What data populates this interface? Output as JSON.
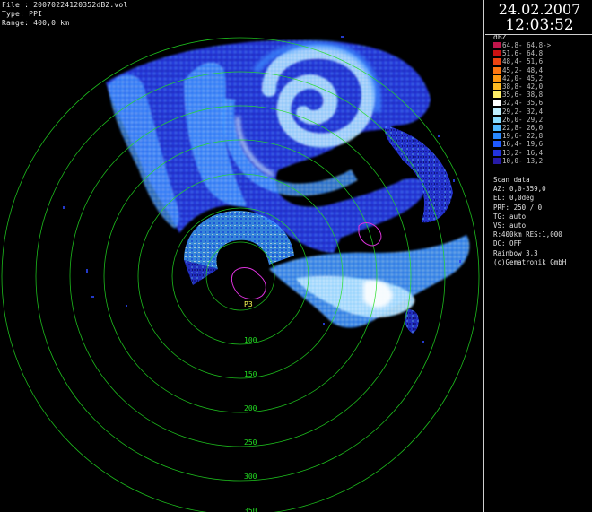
{
  "header": {
    "file": "File : 20070224120352dBZ.vol",
    "type": "Type: PPI",
    "range": "Range: 400,0 km"
  },
  "clock": {
    "date": "24.02.2007",
    "time": "12:03:52"
  },
  "legend": {
    "unit": "dBZ",
    "items": [
      {
        "label": "64,8- 64,8->",
        "color": "#c0154a"
      },
      {
        "label": "51,6- 64,8",
        "color": "#cc1111"
      },
      {
        "label": "48,4- 51,6",
        "color": "#ee4411"
      },
      {
        "label": "45,2- 48,4",
        "color": "#ff7711"
      },
      {
        "label": "42,0- 45,2",
        "color": "#ff9911"
      },
      {
        "label": "38,8- 42,0",
        "color": "#ffbb22"
      },
      {
        "label": "35,6- 38,8",
        "color": "#ffee66"
      },
      {
        "label": "32,4- 35,6",
        "color": "#ffffff"
      },
      {
        "label": "29,2- 32,4",
        "color": "#bfefff"
      },
      {
        "label": "26,0- 29,2",
        "color": "#88dcff"
      },
      {
        "label": "22,8- 26,0",
        "color": "#4fb8ff"
      },
      {
        "label": "19,6- 22,8",
        "color": "#2888ff"
      },
      {
        "label": "16,4- 19,6",
        "color": "#1f5aff"
      },
      {
        "label": "13,2- 16,4",
        "color": "#2233dd"
      },
      {
        "label": "10,0- 13,2",
        "color": "#261aa8"
      }
    ]
  },
  "info": [
    "Scan data",
    "AZ: 0,0-359,0",
    "EL: 0,0deg",
    "PRF: 250 / 0",
    "TG: auto",
    "VS: auto",
    "R:400km RES:1,000",
    "DC: OFF",
    "Rainbow 3.3",
    "(c)Gematronik GmbH"
  ],
  "range_rings": [
    "50",
    "100",
    "150",
    "200",
    "250",
    "300",
    "350"
  ],
  "site_label": "P3",
  "colors": {
    "ring": "#22dd22",
    "boundary": "#dd33dd",
    "panel_border": "#cfcfcf"
  }
}
